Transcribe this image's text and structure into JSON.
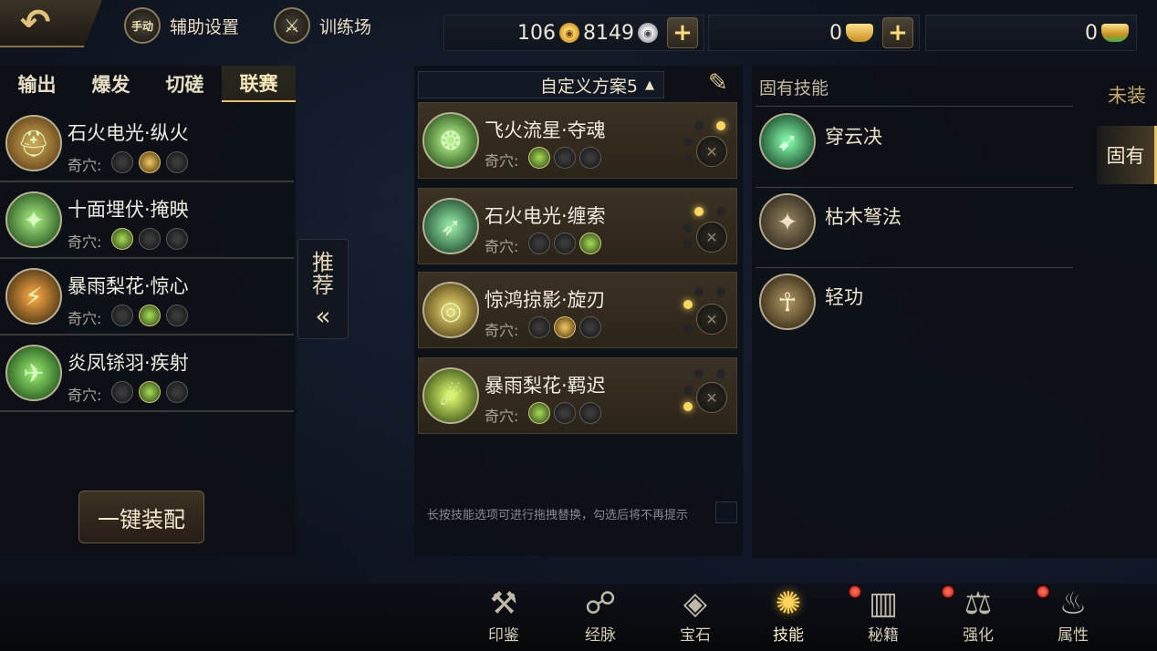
{
  "topbar": {
    "back_icon": "↶",
    "manual_badge": "手动",
    "assist_label": "辅助设置",
    "training_icon": "⚔",
    "training_label": "训练场",
    "gold_amount": "106",
    "gold_icon": "gold-coin",
    "silver_amount": "8149",
    "silver_icon": "silver-coin",
    "ingot_amount": "0",
    "ingot2_amount": "0",
    "plus_label": "+"
  },
  "left_panel": {
    "tabs": [
      {
        "label": "输出"
      },
      {
        "label": "爆发"
      },
      {
        "label": "切磋"
      },
      {
        "label": "联赛"
      }
    ],
    "active_tab": "联赛",
    "qixue_label": "奇穴:",
    "skills": [
      {
        "name": "石火电光·纵火",
        "icon": "⛑",
        "icon_color": "#7a5a2a"
      },
      {
        "name": "十面埋伏·掩映",
        "icon": "✦",
        "icon_color": "#2f6a2a"
      },
      {
        "name": "暴雨梨花·惊心",
        "icon": "⚡",
        "icon_color": "#3a4a2a"
      },
      {
        "name": "炎凤铩羽·疾射",
        "icon": "✈",
        "icon_color": "#2a6a2a"
      }
    ],
    "one_click_label": "一键装配"
  },
  "recommend": {
    "line1": "推",
    "line2": "荐",
    "chevron": "«"
  },
  "middle_panel": {
    "plan_label": "自定义方案5",
    "plan_caret": "▲",
    "brush_icon": "✎",
    "qixue_label": "奇穴:",
    "equipped": [
      {
        "name": "飞火流星·夺魂",
        "icon": "❂",
        "icon_color": "#3a6a2a"
      },
      {
        "name": "石火电光·缠索",
        "icon": "➶",
        "icon_color": "#2a5a3a"
      },
      {
        "name": "惊鸿掠影·旋刃",
        "icon": "◎",
        "icon_color": "#5a5a2a"
      },
      {
        "name": "暴雨梨花·羁迟",
        "icon": "☄",
        "icon_color": "#4a6a1a"
      }
    ],
    "hint": "长按技能选项可进行拖拽替换，勾选后将不再提示"
  },
  "right_panel": {
    "title": "固有技能",
    "innate_skills": [
      {
        "name": "穿云决",
        "icon": "➹",
        "icon_color": "#1a5a3a"
      },
      {
        "name": "枯木弩法",
        "icon": "✦",
        "icon_color": "#4a4030"
      },
      {
        "name": "轻功",
        "icon": "☥",
        "icon_color": "#4a3a20"
      }
    ],
    "side_tabs": [
      {
        "label": "未装"
      },
      {
        "label": "固有"
      }
    ],
    "active_side_tab": "固有"
  },
  "bottom_nav": {
    "items": [
      {
        "label": "印鉴",
        "icon": "seal-icon",
        "glyph": "⚒",
        "badge": false
      },
      {
        "label": "经脉",
        "icon": "meridian-icon",
        "glyph": "☍",
        "badge": false
      },
      {
        "label": "宝石",
        "icon": "gem-icon",
        "glyph": "◈",
        "badge": false
      },
      {
        "label": "技能",
        "icon": "skill-icon",
        "glyph": "✺",
        "badge": false
      },
      {
        "label": "秘籍",
        "icon": "book-icon",
        "glyph": "▥",
        "badge": true
      },
      {
        "label": "强化",
        "icon": "anvil-icon",
        "glyph": "⚖",
        "badge": true
      },
      {
        "label": "属性",
        "icon": "attribute-icon",
        "glyph": "♨",
        "badge": true
      }
    ],
    "active": "技能"
  }
}
